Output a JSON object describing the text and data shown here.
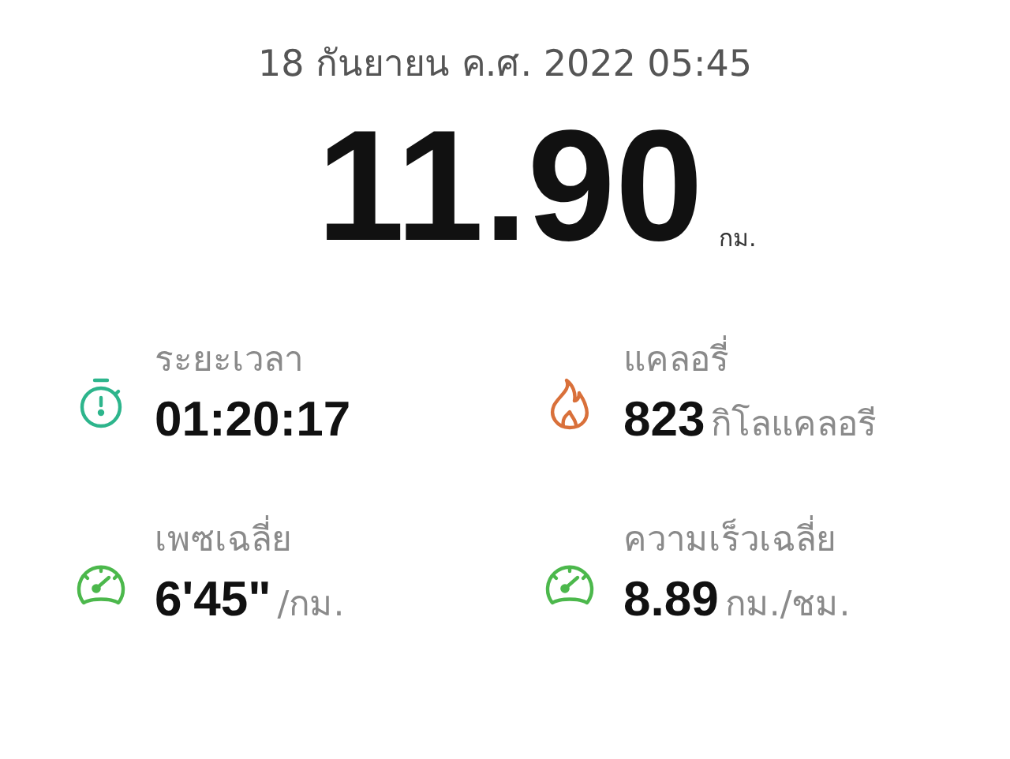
{
  "date": "18 กันยายน ค.ศ. 2022 05:45",
  "distance": {
    "value": "11.90",
    "unit": "กม."
  },
  "stats": [
    {
      "kind": "timer",
      "color": "#2db58c",
      "label": "ระยะเวลา",
      "value": "01:20:17"
    },
    {
      "kind": "flame",
      "color": "#d9703a",
      "label": "แคลอรี่",
      "value": "823",
      "unit": "กิโลแคลอรี"
    },
    {
      "kind": "gauge",
      "color": "#4cb84c",
      "label": "เพซเฉลี่ย",
      "value": "6'45\"",
      "unit": "/กม."
    },
    {
      "kind": "gauge",
      "color": "#4cb84c",
      "label": "ความเร็วเฉลี่ย",
      "value": "8.89",
      "unit": "กม./ชม."
    }
  ]
}
